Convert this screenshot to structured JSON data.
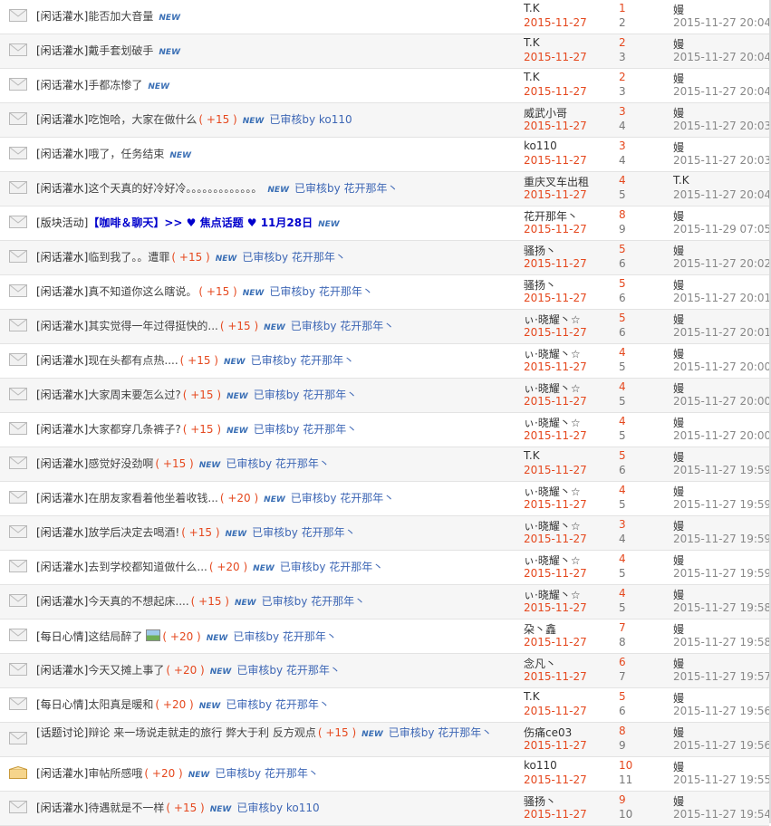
{
  "icons": {
    "read": "envelope-icon",
    "unread": "envelope-open-icon",
    "image": "image-attachment-icon"
  },
  "labels": {
    "new": "NEW"
  },
  "threads": [
    {
      "category": "[闲话灌水]",
      "title": "能否加大音量",
      "credit": "",
      "audit": "",
      "author": "T.K",
      "date": "2015-11-27",
      "replies": "1",
      "views": "2",
      "last_author": "嫚",
      "last_time": "2015-11-27 20:04",
      "alt": false
    },
    {
      "category": "[闲话灌水]",
      "title": "戴手套划破手",
      "credit": "",
      "audit": "",
      "author": "T.K",
      "date": "2015-11-27",
      "replies": "2",
      "views": "3",
      "last_author": "嫚",
      "last_time": "2015-11-27 20:04",
      "alt": true
    },
    {
      "category": "[闲话灌水]",
      "title": "手都冻惨了",
      "credit": "",
      "audit": "",
      "author": "T.K",
      "date": "2015-11-27",
      "replies": "2",
      "views": "3",
      "last_author": "嫚",
      "last_time": "2015-11-27 20:04",
      "alt": false
    },
    {
      "category": "[闲话灌水]",
      "title": "吃饱哈，大家在做什么",
      "credit": "( +15 )",
      "audit": "已审核by ko110",
      "author": "威武小哥",
      "date": "2015-11-27",
      "replies": "3",
      "views": "4",
      "last_author": "嫚",
      "last_time": "2015-11-27 20:03",
      "alt": true
    },
    {
      "category": "[闲话灌水]",
      "title": "哦了，任务结束",
      "credit": "",
      "audit": "",
      "author": "ko110",
      "date": "2015-11-27",
      "replies": "3",
      "views": "4",
      "last_author": "嫚",
      "last_time": "2015-11-27 20:03",
      "alt": false
    },
    {
      "category": "[闲话灌水]",
      "title": "这个天真的好冷好冷。。。。。。。。。。。。。",
      "credit": "",
      "audit": "已审核by 花开那年丶",
      "author": "重庆叉车出租",
      "date": "2015-11-27",
      "replies": "4",
      "views": "5",
      "last_author": "T.K",
      "last_time": "2015-11-27 20:04",
      "alt": true
    },
    {
      "category": "[版块活动]",
      "title": "【咖啡＆聊天】>> ♥ 焦点话题 ♥ 11月28日",
      "credit": "",
      "audit": "",
      "author": "花开那年丶",
      "date": "2015-11-27",
      "replies": "8",
      "views": "9",
      "last_author": "嫚",
      "last_time": "2015-11-29 07:05",
      "alt": false,
      "highlight": true
    },
    {
      "category": "[闲话灌水]",
      "title": "临到我了。。遭罪",
      "credit": "( +15 )",
      "audit": "已审核by 花开那年丶",
      "author": "骚扬丶",
      "date": "2015-11-27",
      "replies": "5",
      "views": "6",
      "last_author": "嫚",
      "last_time": "2015-11-27 20:02",
      "alt": true
    },
    {
      "category": "[闲话灌水]",
      "title": "真不知道你这么瞎说。",
      "credit": "( +15 )",
      "audit": "已审核by 花开那年丶",
      "author": "骚扬丶",
      "date": "2015-11-27",
      "replies": "5",
      "views": "6",
      "last_author": "嫚",
      "last_time": "2015-11-27 20:01",
      "alt": false
    },
    {
      "category": "[闲话灌水]",
      "title": "其实觉得一年过得挺快的...",
      "credit": "( +15 )",
      "audit": "已审核by 花开那年丶",
      "author": "ぃ·晓耀丶☆",
      "date": "2015-11-27",
      "replies": "5",
      "views": "6",
      "last_author": "嫚",
      "last_time": "2015-11-27 20:01",
      "alt": true
    },
    {
      "category": "[闲话灌水]",
      "title": "现在头都有点热....",
      "credit": "( +15 )",
      "audit": "已审核by 花开那年丶",
      "author": "ぃ·晓耀丶☆",
      "date": "2015-11-27",
      "replies": "4",
      "views": "5",
      "last_author": "嫚",
      "last_time": "2015-11-27 20:00",
      "alt": false
    },
    {
      "category": "[闲话灌水]",
      "title": "大家周末要怎么过?",
      "credit": "( +15 )",
      "audit": "已审核by 花开那年丶",
      "author": "ぃ·晓耀丶☆",
      "date": "2015-11-27",
      "replies": "4",
      "views": "5",
      "last_author": "嫚",
      "last_time": "2015-11-27 20:00",
      "alt": true
    },
    {
      "category": "[闲话灌水]",
      "title": "大家都穿几条裤子?",
      "credit": "( +15 )",
      "audit": "已审核by 花开那年丶",
      "author": "ぃ·晓耀丶☆",
      "date": "2015-11-27",
      "replies": "4",
      "views": "5",
      "last_author": "嫚",
      "last_time": "2015-11-27 20:00",
      "alt": false
    },
    {
      "category": "[闲话灌水]",
      "title": "感觉好没劲啊",
      "credit": "( +15 )",
      "audit": "已审核by 花开那年丶",
      "author": "T.K",
      "date": "2015-11-27",
      "replies": "5",
      "views": "6",
      "last_author": "嫚",
      "last_time": "2015-11-27 19:59",
      "alt": true
    },
    {
      "category": "[闲话灌水]",
      "title": "在朋友家看着他坐着收钱...",
      "credit": "( +20 )",
      "audit": "已审核by 花开那年丶",
      "author": "ぃ·晓耀丶☆",
      "date": "2015-11-27",
      "replies": "4",
      "views": "5",
      "last_author": "嫚",
      "last_time": "2015-11-27 19:59",
      "alt": false
    },
    {
      "category": "[闲话灌水]",
      "title": "放学后决定去喝酒!",
      "credit": "( +15 )",
      "audit": "已审核by 花开那年丶",
      "author": "ぃ·晓耀丶☆",
      "date": "2015-11-27",
      "replies": "3",
      "views": "4",
      "last_author": "嫚",
      "last_time": "2015-11-27 19:59",
      "alt": true
    },
    {
      "category": "[闲话灌水]",
      "title": "去到学校都知道做什么...",
      "credit": "( +20 )",
      "audit": "已审核by 花开那年丶",
      "author": "ぃ·晓耀丶☆",
      "date": "2015-11-27",
      "replies": "4",
      "views": "5",
      "last_author": "嫚",
      "last_time": "2015-11-27 19:59",
      "alt": false
    },
    {
      "category": "[闲话灌水]",
      "title": "今天真的不想起床....",
      "credit": "( +15 )",
      "audit": "已审核by 花开那年丶",
      "author": "ぃ·晓耀丶☆",
      "date": "2015-11-27",
      "replies": "4",
      "views": "5",
      "last_author": "嫚",
      "last_time": "2015-11-27 19:58",
      "alt": true
    },
    {
      "category": "[每日心情]",
      "title": "这结局醉了",
      "credit": "( +20 )",
      "audit": "已审核by 花开那年丶",
      "author": "朶丶鑫",
      "date": "2015-11-27",
      "replies": "7",
      "views": "8",
      "last_author": "嫚",
      "last_time": "2015-11-27 19:58",
      "alt": false,
      "image": true
    },
    {
      "category": "[闲话灌水]",
      "title": "今天又摊上事了",
      "credit": "( +20 )",
      "audit": "已审核by 花开那年丶",
      "author": "念凡丶",
      "date": "2015-11-27",
      "replies": "6",
      "views": "7",
      "last_author": "嫚",
      "last_time": "2015-11-27 19:57",
      "alt": true
    },
    {
      "category": "[每日心情]",
      "title": "太阳真是暖和",
      "credit": "( +20 )",
      "audit": "已审核by 花开那年丶",
      "author": "T.K",
      "date": "2015-11-27",
      "replies": "5",
      "views": "6",
      "last_author": "嫚",
      "last_time": "2015-11-27 19:56",
      "alt": false
    },
    {
      "category": "[话题讨论]",
      "title": "辩论 来一场说走就走的旅行 弊大于利 反方观点",
      "credit": "( +15 )",
      "audit": "已审核by 花开那年丶",
      "author": "伤痛ce03",
      "date": "2015-11-27",
      "replies": "8",
      "views": "9",
      "last_author": "嫚",
      "last_time": "2015-11-27 19:56",
      "alt": true,
      "wrap": true
    },
    {
      "category": "[闲话灌水]",
      "title": "审帖所感哦",
      "credit": "( +20 )",
      "audit": "已审核by 花开那年丶",
      "author": "ko110",
      "date": "2015-11-27",
      "replies": "10",
      "views": "11",
      "last_author": "嫚",
      "last_time": "2015-11-27 19:55",
      "alt": false,
      "unread": true
    },
    {
      "category": "[闲话灌水]",
      "title": "待遇就是不一样",
      "credit": "( +15 )",
      "audit": "已审核by ko110",
      "author": "骚扬丶",
      "date": "2015-11-27",
      "replies": "9",
      "views": "10",
      "last_author": "嫚",
      "last_time": "2015-11-27 19:54",
      "alt": true
    }
  ]
}
